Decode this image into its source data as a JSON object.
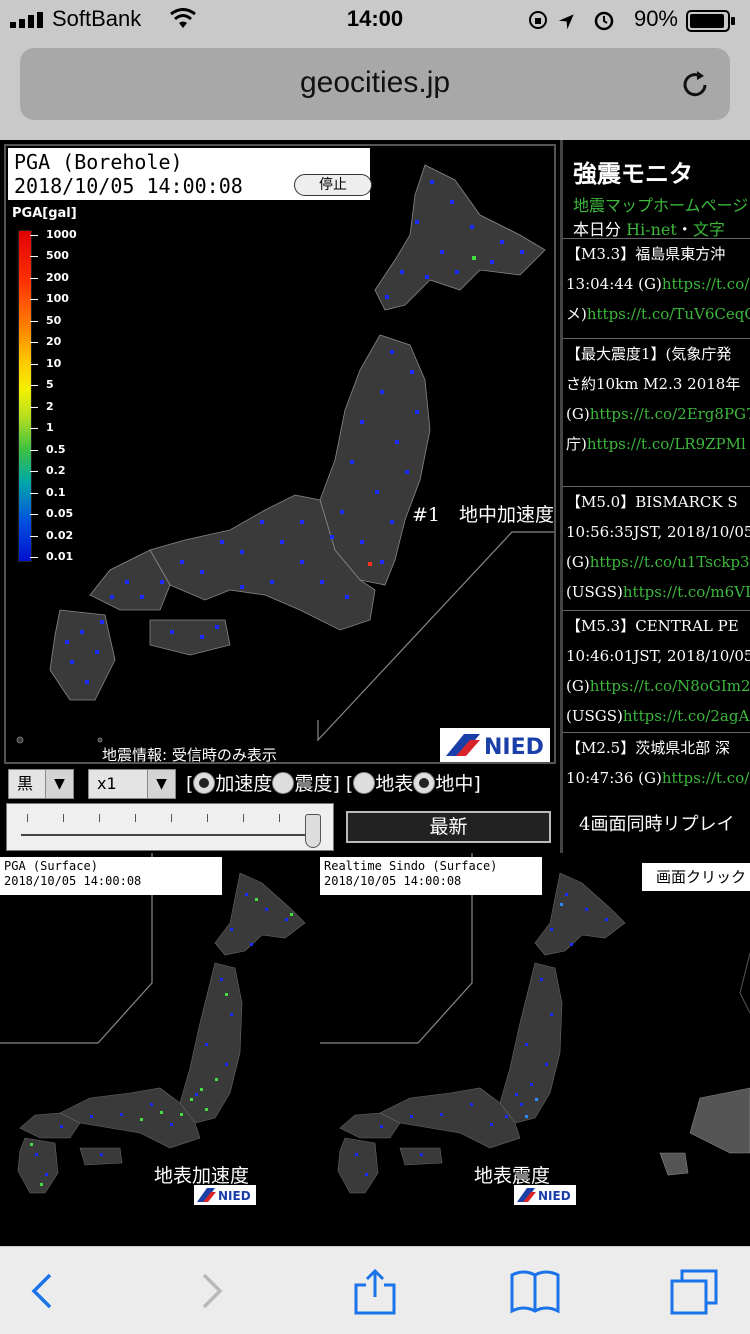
{
  "status_bar": {
    "carrier": "SoftBank",
    "time": "14:00",
    "battery": "90%"
  },
  "browser": {
    "url": "geocities.jp"
  },
  "main_map": {
    "title": "PGA (Borehole)",
    "timestamp": "2018/10/05 14:00:08",
    "stop_label": "停止",
    "legend_title": "PGA[gal]",
    "scale_ticks": [
      "1000",
      "500",
      "200",
      "100",
      "50",
      "20",
      "10",
      "5",
      "2",
      "1",
      "0.5",
      "0.2",
      "0.1",
      "0.05",
      "0.02",
      "0.01"
    ],
    "inset_label": "#1　地中加速度",
    "disp_note": "地震情報: 受信時のみ表示",
    "logo": "NIED"
  },
  "controls": {
    "color_select": "黒",
    "speed_select": "x1",
    "radio_open1": "[",
    "radio_accel": "加速度",
    "radio_intensity": "震度]",
    "radio_open2": "[",
    "radio_surface": "地表",
    "radio_borehole": "地中]",
    "latest_button": "最新"
  },
  "side_panel": {
    "title": "強震モニタ",
    "home_link": "地震マップホームページ",
    "today_prefix": "本日分",
    "today_hinet": "Hi-net",
    "today_sep": "・",
    "today_text": "文字",
    "news": [
      {
        "lines": [
          {
            "text": "【M3.3】福島県東方沖",
            "color": "white"
          },
          {
            "text": "13:04:44 (G)",
            "link": "https://t.co/7"
          },
          {
            "text": "メ)",
            "link": "https://t.co/TuV6CeqC"
          }
        ]
      },
      {
        "lines": [
          {
            "text": "【最大震度1】(気象庁発",
            "color": "white"
          },
          {
            "text": "さ約10km M2.3 2018年",
            "color": "white"
          },
          {
            "text": "(G)",
            "link": "https://t.co/2Erg8PG7"
          },
          {
            "text": "庁)",
            "link": "https://t.co/LR9ZPMl"
          }
        ]
      },
      {
        "lines": [
          {
            "text": "【M5.0】BISMARCK S",
            "color": "white"
          },
          {
            "text": "10:56:35JST, 2018/10/05",
            "color": "white"
          },
          {
            "text": "(G)",
            "link": "https://t.co/u1Tsckp3y"
          },
          {
            "text": "(USGS)",
            "link": "https://t.co/m6VI"
          }
        ]
      },
      {
        "lines": [
          {
            "text": "【M5.3】CENTRAL PE",
            "color": "white"
          },
          {
            "text": "10:46:01JST, 2018/10/05",
            "color": "white"
          },
          {
            "text": "(G)",
            "link": "https://t.co/N8oGIm2"
          },
          {
            "text": "(USGS)",
            "link": "https://t.co/2agA"
          }
        ]
      },
      {
        "lines": [
          {
            "text": "【M2.5】茨城県北部 深",
            "color": "white"
          },
          {
            "text": "10:47:36 (G)",
            "link": "https://t.co/5"
          }
        ]
      }
    ],
    "replay": "4画面同時リプレイ"
  },
  "bottom_maps": {
    "left": {
      "title": "PGA (Surface)",
      "timestamp": "2018/10/05 14:00:08",
      "label": "地表加速度",
      "logo": "NIED"
    },
    "middle": {
      "title": "Realtime Sindo (Surface)",
      "timestamp": "2018/10/05 14:00:08",
      "label": "地表震度",
      "logo": "NIED"
    },
    "right_hint": "画面クリック"
  },
  "colors": {
    "station_blue": "#1a2cff",
    "station_green": "#44dd44",
    "link_green": "#3cb83c",
    "land": "#3a3a3a"
  }
}
